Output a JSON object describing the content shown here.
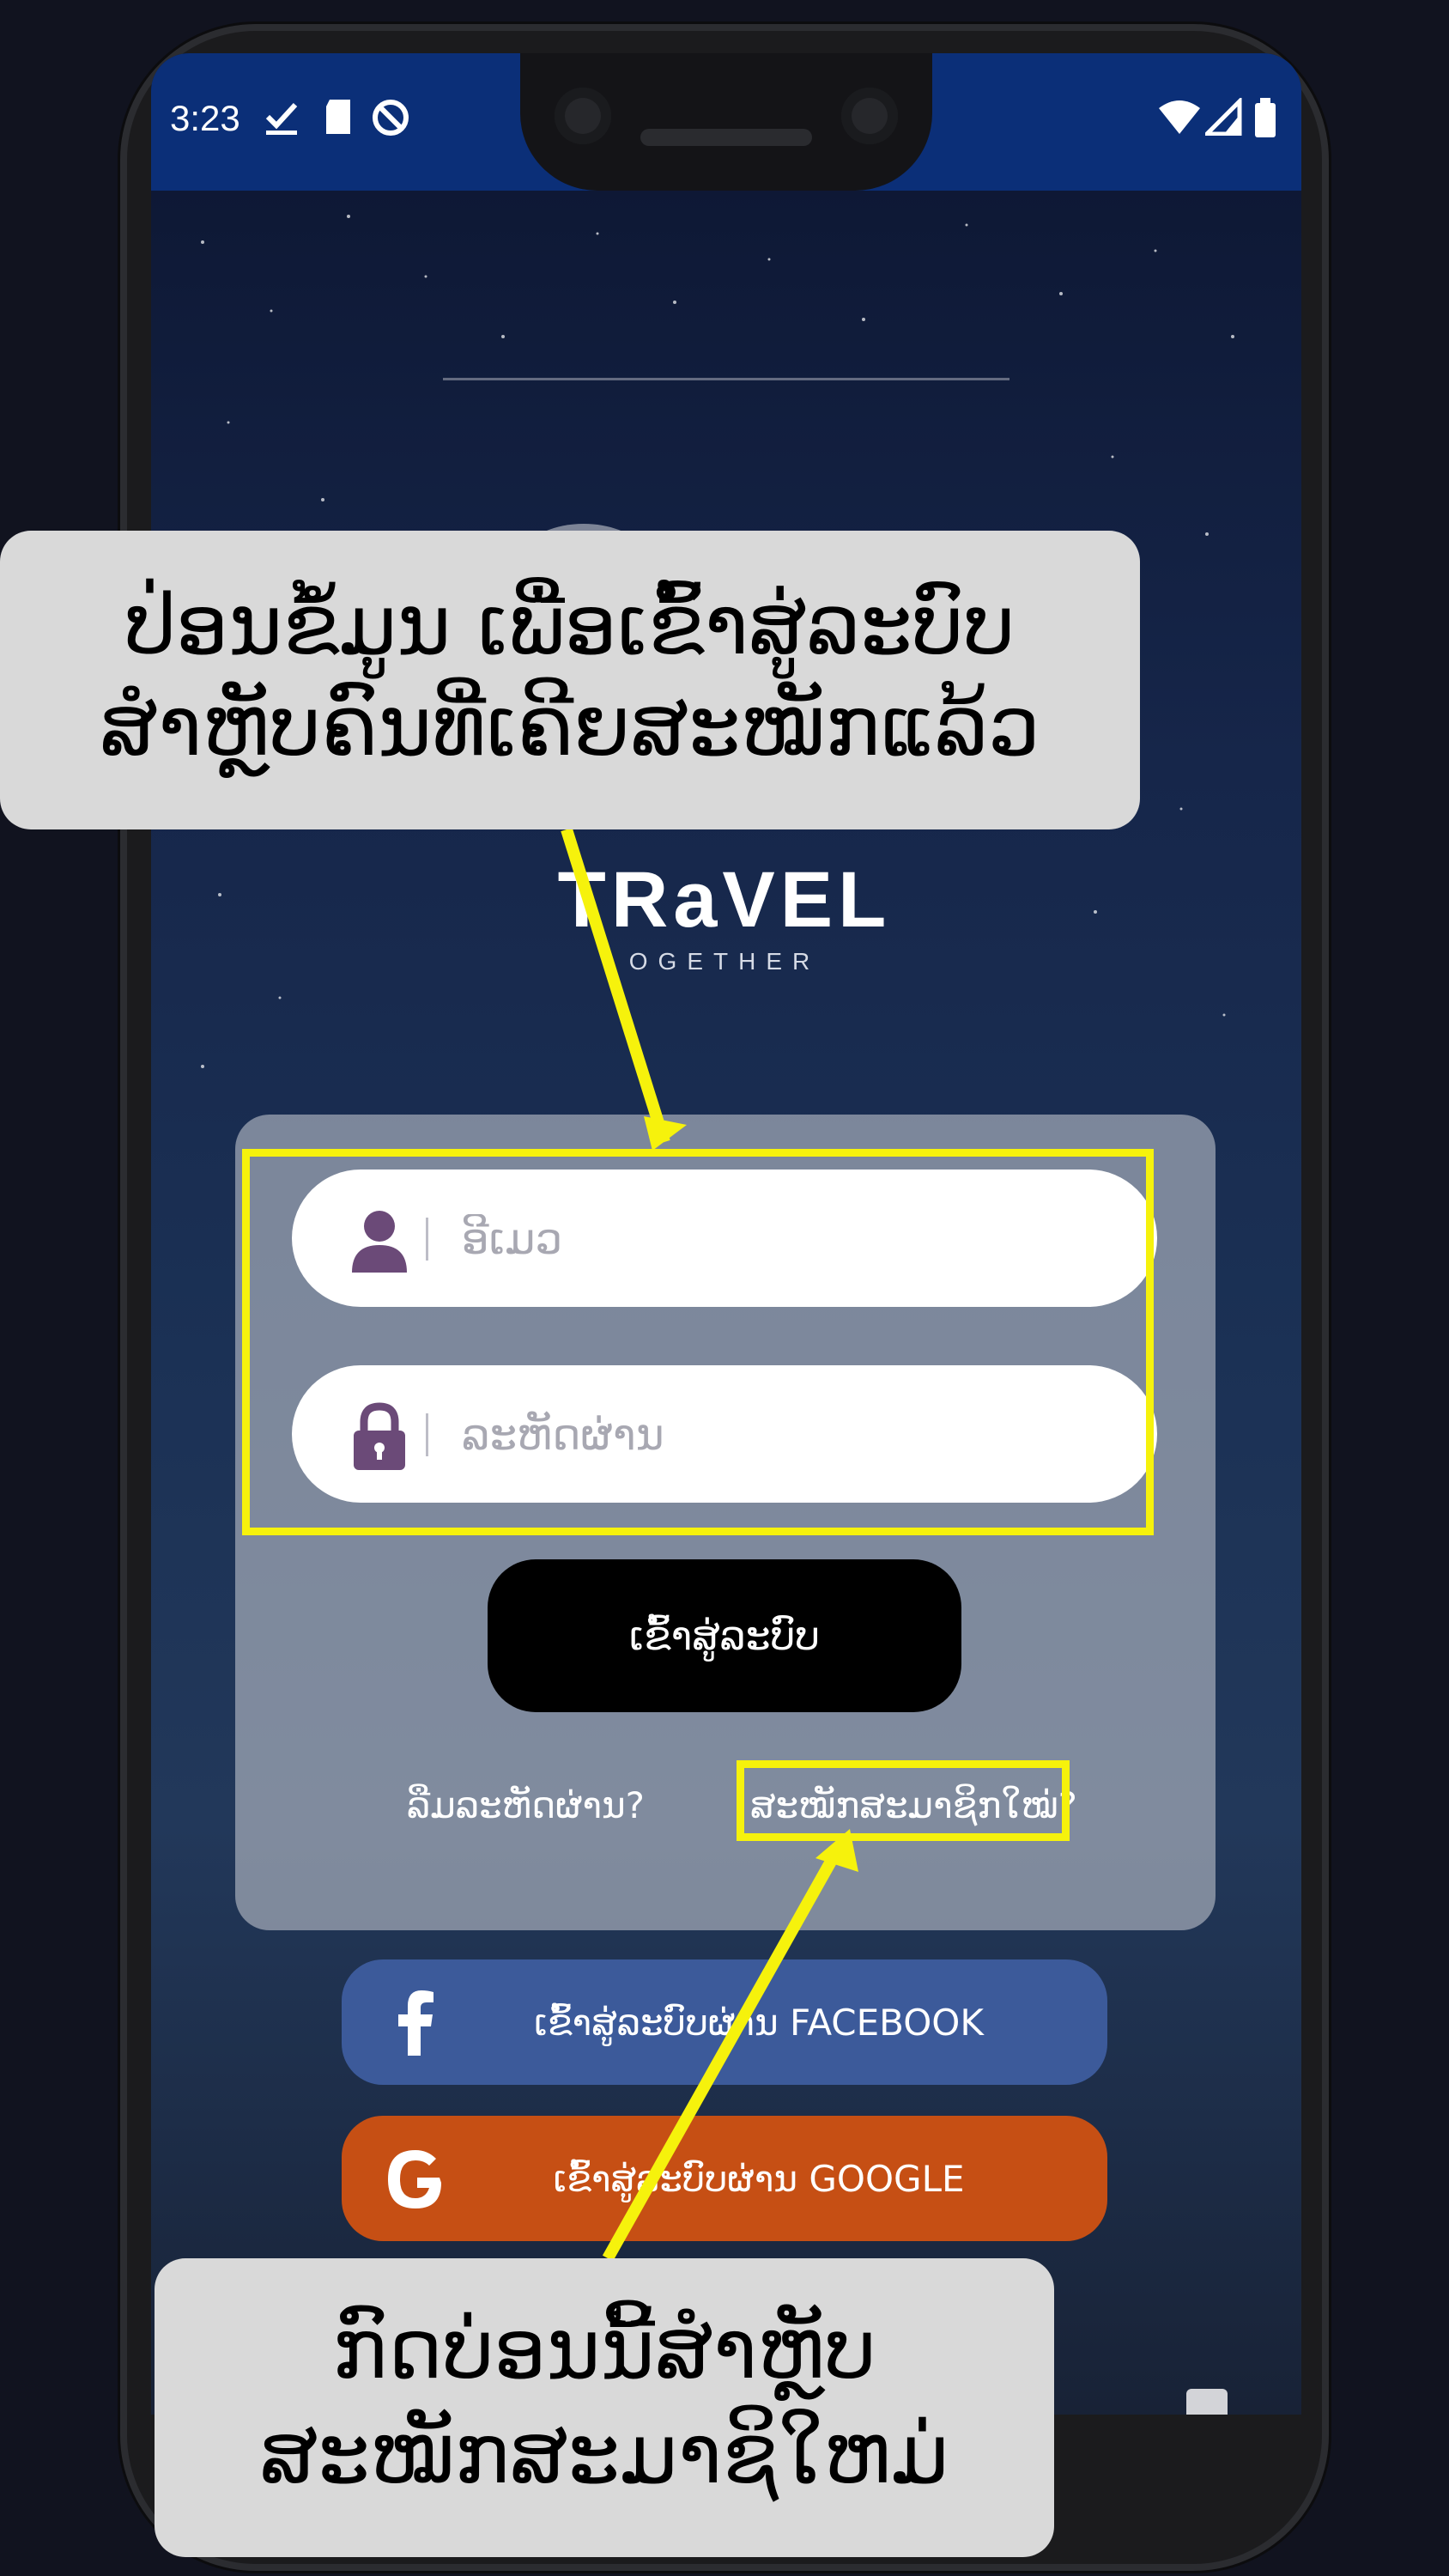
{
  "status_bar": {
    "time": "3:23",
    "icons_left": [
      "check-icon",
      "sd-card-icon",
      "data-saver-icon"
    ],
    "icons_right": [
      "wifi-icon",
      "signal-icon",
      "battery-icon"
    ]
  },
  "brand": {
    "name": "TRaVEL",
    "tagline": "OGETHER"
  },
  "login_form": {
    "username_placeholder": "ອີເມວ",
    "password_placeholder": "ລະຫັດຜ່ານ",
    "login_button": "ເຂົ້າສູ່ລະບົບ",
    "forgot_password": "ລືມລະຫັດຜ່ານ?",
    "register_link": "ສະໝັກສະມາຊິກໃໝ່?"
  },
  "social": {
    "facebook_label": "ເຂົ້າສູ່ລະບົບຜ່ານ FACEBOOK",
    "google_label": "ເຂົ້າສູ່ລະບົບຜ່ານ GOOGLE"
  },
  "annotations": {
    "top_callout_line1": "ປ່ອນຂໍ້ມູນ ເພື່ອເຂົ້າສູ່ລະບົບ",
    "top_callout_line2": "ສຳຫຼັບຄົນທີ່ເຄີຍສະໝັກແລ້ວ",
    "bottom_callout_line1": "ກົດບ່ອນນີ້ສຳຫຼັບ",
    "bottom_callout_line2": "ສະໝັກສະມາຊິໃຫມ່"
  },
  "colors": {
    "status_bar": "#0b2f78",
    "highlight": "#f6f20c",
    "facebook": "#3c5a9a",
    "google": "#c64f14",
    "login_button": "#000000",
    "icon_purple": "#6b4a78"
  }
}
